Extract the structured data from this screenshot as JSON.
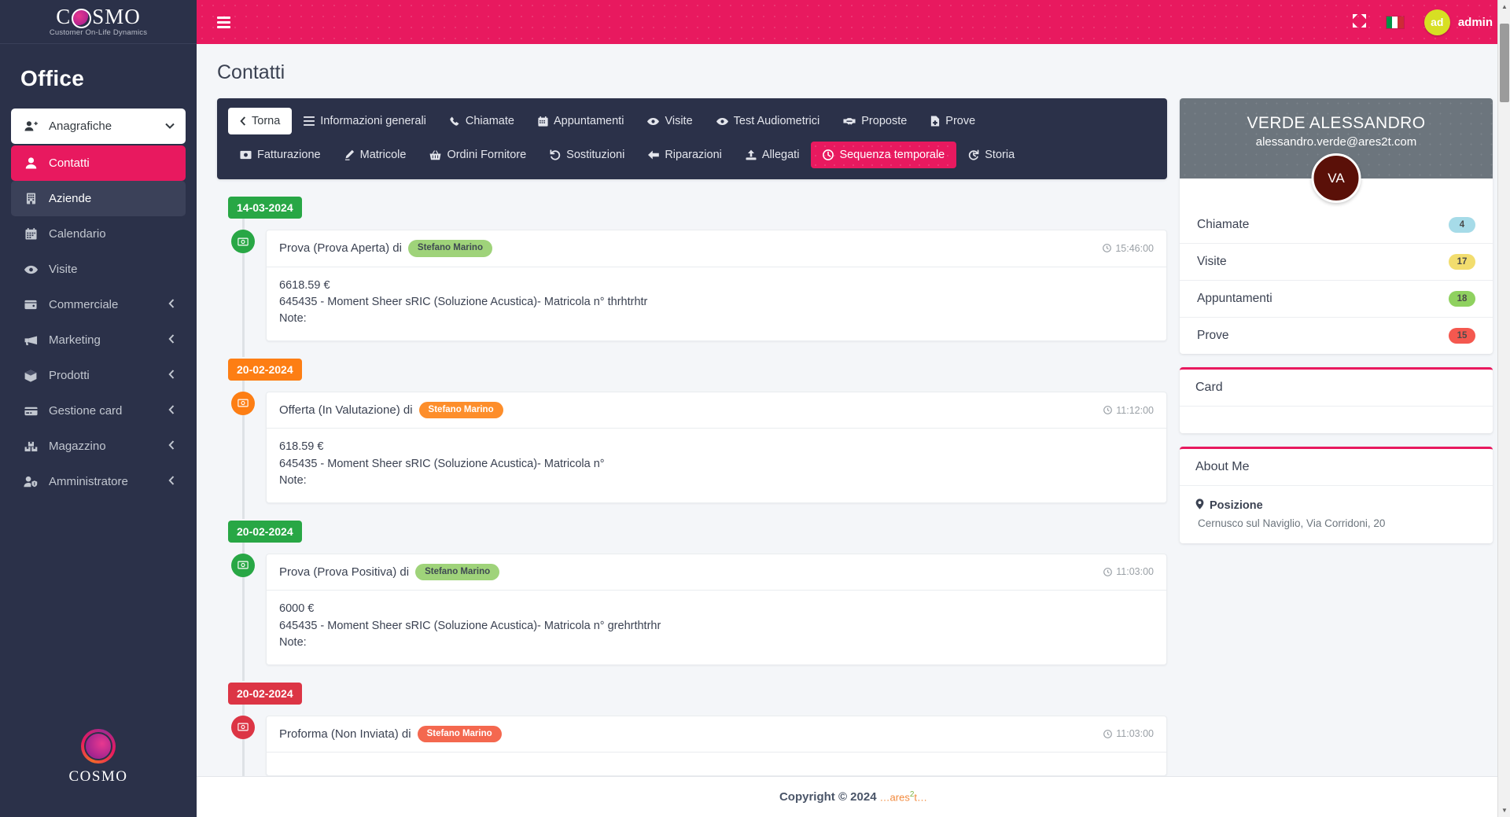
{
  "brand": {
    "logo_word": "C SMO",
    "logo_pre": "C",
    "logo_post": "SMO",
    "tagline": "Customer On-Life Dynamics",
    "section_title": "Office",
    "footer_logo_text": "COSMO"
  },
  "sidebar": {
    "items": [
      {
        "label": "Anagrafiche",
        "icon": "user-plus-icon",
        "state": "dropdown-open",
        "caret": "⌄"
      },
      {
        "label": "Contatti",
        "icon": "user-icon",
        "state": "active"
      },
      {
        "label": "Aziende",
        "icon": "building-icon",
        "state": "hovered"
      },
      {
        "label": "Calendario",
        "icon": "calendar-icon",
        "state": "normal"
      },
      {
        "label": "Visite",
        "icon": "eye-icon",
        "state": "normal"
      },
      {
        "label": "Commerciale",
        "icon": "wallet-icon",
        "state": "normal",
        "caret": "‹"
      },
      {
        "label": "Marketing",
        "icon": "megaphone-icon",
        "state": "normal",
        "caret": "‹"
      },
      {
        "label": "Prodotti",
        "icon": "box-icon",
        "state": "normal",
        "caret": "‹"
      },
      {
        "label": "Gestione card",
        "icon": "card-icon",
        "state": "normal",
        "caret": "‹"
      },
      {
        "label": "Magazzino",
        "icon": "warehouse-icon",
        "state": "normal",
        "caret": "‹"
      },
      {
        "label": "Amministratore",
        "icon": "user-shield-icon",
        "state": "normal",
        "caret": "‹"
      }
    ]
  },
  "navbar": {
    "menu_toggle": "hamburger-icon",
    "fullscreen_icon": "expand-arrows-icon",
    "language_flag": "italy-flag-icon",
    "avatar_initials": "ad",
    "user_name": "admin",
    "avatar_color": "#d7df23",
    "bg_color": "#e8195f"
  },
  "page": {
    "title": "Contatti"
  },
  "tabs": {
    "row1": [
      {
        "label": "Torna",
        "icon": "chevron-left-icon",
        "style": "light"
      },
      {
        "label": "Informazioni generali",
        "icon": "list-icon",
        "style": "dark"
      },
      {
        "label": "Chiamate",
        "icon": "phone-icon",
        "style": "dark"
      },
      {
        "label": "Appuntamenti",
        "icon": "calendar-icon",
        "style": "dark"
      },
      {
        "label": "Visite",
        "icon": "eye-icon",
        "style": "dark"
      },
      {
        "label": "Test Audiometrici",
        "icon": "eye-icon",
        "style": "dark"
      },
      {
        "label": "Proposte",
        "icon": "handshake-icon",
        "style": "dark"
      },
      {
        "label": "Prove",
        "icon": "file-medical-icon",
        "style": "dark"
      }
    ],
    "row2": [
      {
        "label": "Fatturazione",
        "icon": "money-bill-icon",
        "style": "dark"
      },
      {
        "label": "Matricole",
        "icon": "hearing-aid-icon",
        "style": "dark"
      },
      {
        "label": "Ordini Fornitore",
        "icon": "basket-icon",
        "style": "dark"
      },
      {
        "label": "Sostituzioni",
        "icon": "undo-icon",
        "style": "dark"
      },
      {
        "label": "Riparazioni",
        "icon": "arrow-left-icon",
        "style": "dark"
      },
      {
        "label": "Allegati",
        "icon": "upload-icon",
        "style": "dark"
      },
      {
        "label": "Sequenza temporale",
        "icon": "clock-icon",
        "style": "active"
      },
      {
        "label": "Storia",
        "icon": "history-icon",
        "style": "dark"
      }
    ]
  },
  "timeline": [
    {
      "date": "14-03-2024",
      "date_color": "#28a745",
      "badge_color": "#28a745",
      "badge_icon": "money-bill-icon",
      "title": "Prova (Prova Aperta) di",
      "pill": "Stefano Marino",
      "pill_color": "#9fd37a",
      "time": "15:46:00",
      "amount": "6618.59 €",
      "detail": "645435 - Moment Sheer sRIC (Soluzione Acustica)- Matricola n° thrhtrhtr",
      "note": "Note:"
    },
    {
      "date": "20-02-2024",
      "date_color": "#fd7e14",
      "badge_color": "#fd7e14",
      "badge_icon": "money-bill-icon",
      "title": "Offerta (In Valutazione) di",
      "pill": "Stefano Marino",
      "pill_color": "#fd8e2b",
      "time": "11:12:00",
      "amount": "618.59 €",
      "detail": "645435 - Moment Sheer sRIC (Soluzione Acustica)- Matricola n°",
      "note": "Note:"
    },
    {
      "date": "20-02-2024",
      "date_color": "#28a745",
      "badge_color": "#28a745",
      "badge_icon": "money-bill-icon",
      "title": "Prova (Prova Positiva) di",
      "pill": "Stefano Marino",
      "pill_color": "#9fd37a",
      "time": "11:03:00",
      "amount": "6000 €",
      "detail": "645435 - Moment Sheer sRIC (Soluzione Acustica)- Matricola n° grehrthtrhr",
      "note": "Note:"
    },
    {
      "date": "20-02-2024",
      "date_color": "#dc3545",
      "badge_color": "#dc3545",
      "badge_icon": "money-bill-icon",
      "title": "Proforma (Non Inviata) di",
      "pill": "Stefano Marino",
      "pill_color": "#f4684f",
      "time": "11:03:00",
      "amount": "",
      "detail": "",
      "note": ""
    }
  ],
  "contact_card": {
    "name": "VERDE ALESSANDRO",
    "email": "alessandro.verde@ares2t.com",
    "avatar_initials": "VA",
    "stats": [
      {
        "label": "Chiamate",
        "value": "4",
        "color": "#a6dbe8"
      },
      {
        "label": "Visite",
        "value": "17",
        "color": "#f2dd6e"
      },
      {
        "label": "Appuntamenti",
        "value": "18",
        "color": "#8fd15f"
      },
      {
        "label": "Prove",
        "value": "15",
        "color": "#f4584f"
      }
    ],
    "card_section": {
      "title": "Card",
      "body": ""
    },
    "about_section": {
      "title": "About Me",
      "position_label": "Posizione",
      "position_icon": "map-marker-icon",
      "position_value": "Cernusco sul Naviglio, Via Corridoni, 20"
    },
    "accent_color": "#e8195f"
  },
  "footer": {
    "copyright": "Copyright © 2024",
    "brand": "ares",
    "brand_sup": "2",
    "brand_post": "t"
  }
}
